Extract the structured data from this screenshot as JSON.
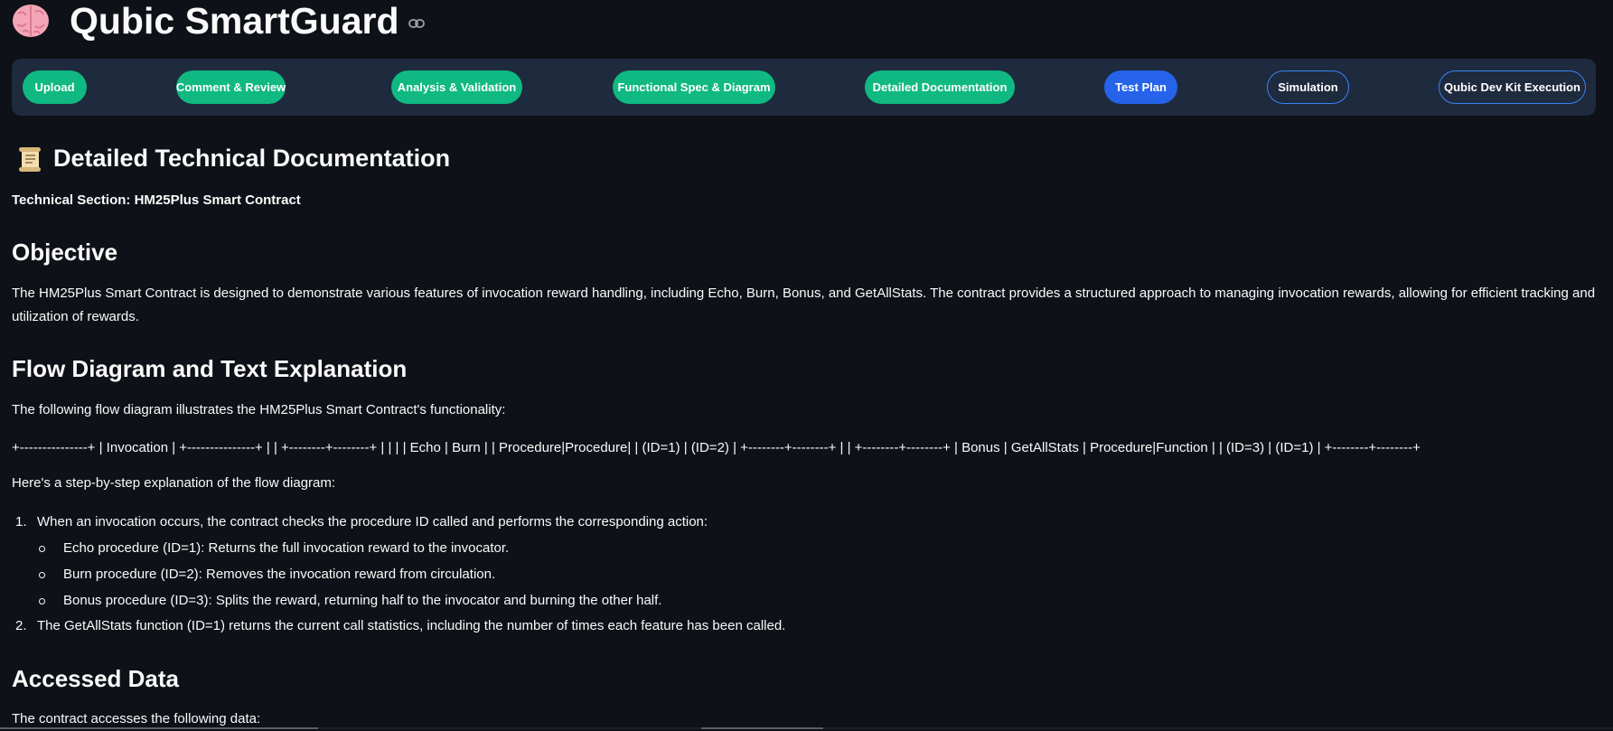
{
  "app": {
    "title": "Qubic SmartGuard"
  },
  "nav": {
    "steps": [
      {
        "label": "Upload",
        "state": "done"
      },
      {
        "label": "Comment & Review",
        "state": "done"
      },
      {
        "label": "Analysis & Validation",
        "state": "done"
      },
      {
        "label": "Functional Spec & Diagram",
        "state": "done"
      },
      {
        "label": "Detailed Documentation",
        "state": "done"
      },
      {
        "label": "Test Plan",
        "state": "active"
      },
      {
        "label": "Simulation",
        "state": "todo"
      },
      {
        "label": "Qubic Dev Kit Execution",
        "state": "todo"
      }
    ]
  },
  "doc": {
    "title": "Detailed Technical Documentation",
    "section_label": "Technical Section: HM25Plus Smart Contract",
    "objective_heading": "Objective",
    "objective_text_1": "The HM25Plus Smart Contract is designed to demonstrate various features of invocation reward handling, including Echo, Burn, Bonus, and GetAllStats. The contract provides a structured approach to managing invocation rewards, allowing for efficient tracking and",
    "objective_text_2": "utilization of rewards.",
    "flow_heading": "Flow Diagram and Text Explanation",
    "flow_intro": "The following flow diagram illustrates the HM25Plus Smart Contract's functionality:",
    "flow_ascii": "+---------------+ | Invocation | +---------------+ | | +--------+--------+ | | | | Echo | Burn | | Procedure|Procedure| | (ID=1) | (ID=2) | +--------+--------+ | | +--------+--------+ | Bonus | GetAllStats | Procedure|Function | | (ID=3) | (ID=1) | +--------+--------+",
    "step_intro": "Here's a step-by-step explanation of the flow diagram:",
    "steps": [
      {
        "num": "1.",
        "text": "When an invocation occurs, the contract checks the procedure ID called and performs the corresponding action:"
      },
      {
        "num": "2.",
        "text": "The GetAllStats function (ID=1) returns the current call statistics, including the number of times each feature has been called."
      }
    ],
    "sub_steps": [
      "Echo procedure (ID=1): Returns the full invocation reward to the invocator.",
      "Burn procedure (ID=2): Removes the invocation reward from circulation.",
      "Bonus procedure (ID=3): Splits the reward, returning half to the invocator and burning the other half."
    ],
    "accessed_heading": "Accessed Data",
    "accessed_intro": "The contract accesses the following data:"
  },
  "colors": {
    "background": "#0e1117",
    "nav_bar": "#1e2a3d",
    "done": "#10b981",
    "active": "#2563eb",
    "todo_border": "#3b82f6"
  },
  "icons": {
    "app": "brain-icon",
    "title_link": "link-icon",
    "doc": "scroll-icon"
  }
}
